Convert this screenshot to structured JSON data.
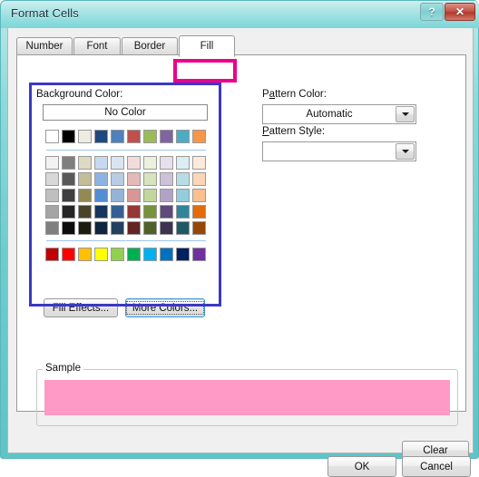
{
  "window": {
    "title": "Format Cells",
    "help_label": "?",
    "close_label": "✕"
  },
  "tabs": [
    {
      "label": "Number",
      "active": false
    },
    {
      "label": "Font",
      "active": false
    },
    {
      "label": "Border",
      "active": false
    },
    {
      "label": "Fill",
      "active": true
    }
  ],
  "annotations": {
    "fill_tab_highlight_color": "#ec008c",
    "background_color_highlight_color": "#3b39c4"
  },
  "fill_tab": {
    "background_color": {
      "label": "Background Color:",
      "no_color_label": "No Color",
      "theme_row": [
        "#ffffff",
        "#000000",
        "#eeece1",
        "#1f497d",
        "#4f81bd",
        "#c0504d",
        "#9bbb59",
        "#8064a2",
        "#4bacc6",
        "#f79646"
      ],
      "tint_rows": [
        [
          "#f2f2f2",
          "#7f7f7f",
          "#ddd9c3",
          "#c6d9f0",
          "#dbe5f1",
          "#f2dcdb",
          "#ebf1dd",
          "#e5e0ec",
          "#dbeef3",
          "#fdeada"
        ],
        [
          "#d8d8d8",
          "#595959",
          "#c4bd97",
          "#8db3e2",
          "#b8cce4",
          "#e5b9b7",
          "#d7e3bc",
          "#ccc1d9",
          "#b7dde8",
          "#fbd5b5"
        ],
        [
          "#bfbfbf",
          "#3f3f3f",
          "#938953",
          "#548dd4",
          "#95b3d7",
          "#d99694",
          "#c3d69b",
          "#b2a2c7",
          "#92cddc",
          "#fac08f"
        ],
        [
          "#a5a5a5",
          "#262626",
          "#494429",
          "#17365d",
          "#366092",
          "#953734",
          "#76923c",
          "#5f497a",
          "#31859b",
          "#e36c09"
        ],
        [
          "#7f7f7f",
          "#0c0c0c",
          "#1d1b10",
          "#0f243e",
          "#244061",
          "#632423",
          "#4f6128",
          "#3f3151",
          "#205867",
          "#974806"
        ]
      ],
      "standard_row": [
        "#c00000",
        "#ff0000",
        "#ffc000",
        "#ffff00",
        "#92d050",
        "#00b050",
        "#00b0f0",
        "#0070c0",
        "#002060",
        "#7030a0"
      ],
      "fill_effects_label": "Fill Effects...",
      "more_colors_label": "More Colors...",
      "more_colors_focused": true
    },
    "pattern_color": {
      "label": "Pattern Color:",
      "value": "Automatic"
    },
    "pattern_style": {
      "label": "Pattern Style:",
      "value": ""
    },
    "sample": {
      "legend": "Sample",
      "swatch_color": "#ff9ac6"
    },
    "clear_label": "Clear"
  },
  "footer": {
    "ok_label": "OK",
    "cancel_label": "Cancel"
  }
}
